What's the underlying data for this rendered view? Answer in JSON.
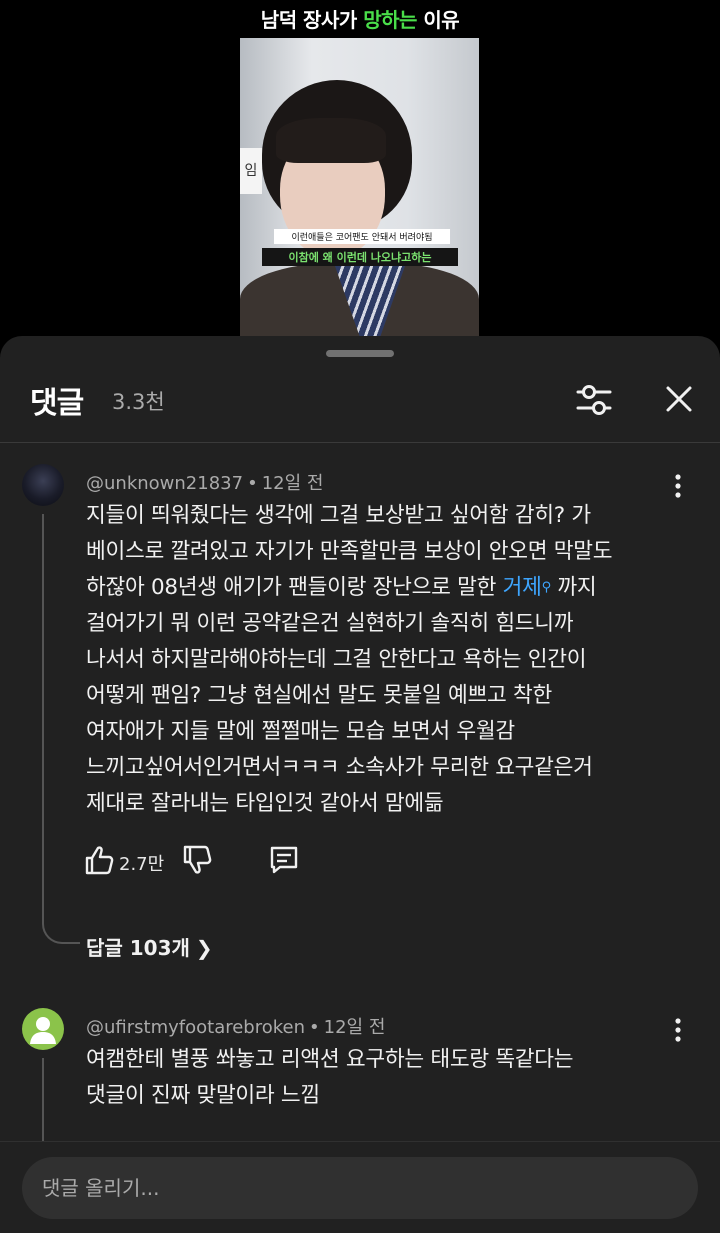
{
  "video": {
    "title_part1": "남덕 장사가 ",
    "title_highlight": "망하는",
    "title_part2": " 이유",
    "caption1": "이런애들은 코어팬도 안돼서 버려야됨",
    "caption2": "이참에 왜 이런데 나오냐고하는",
    "sign_text": "임"
  },
  "header": {
    "title": "댓글",
    "count": "3.3천",
    "filter_icon": "filter-sliders-icon",
    "close_icon": "close-icon"
  },
  "comments": [
    {
      "author": "@unknown21837",
      "time": "12일 전",
      "lines": [
        "지들이 띄워줬다는 생각에 그걸 보상받고 싶어함 감히? 가",
        "베이스로 깔려있고 자기가 만족할만큼 보상이 안오면 막말도",
        "하잖아 08년생 애기가 팬들이랑 장난으로 말한 ",
        "걸어가기 뭐 이런 공약같은건 실현하기 솔직히 힘드니까",
        "나서서 하지말라해야하는데 그걸 안한다고 욕하는 인간이",
        "어떻게 팬임? 그냥 현실에선 말도 못붙일 예쁘고 착한",
        "여자애가 지들 말에 쩔쩔매는 모습 보면서 우월감",
        "느끼고싶어서인거면서ㅋㅋㅋ 소속사가 무리한 요구같은거",
        "제대로 잘라내는 타입인것 같아서 맘에듦"
      ],
      "link_text": "거제",
      "line3_tail": " 까지",
      "likes": "2.7만",
      "replies": "답글 103개"
    },
    {
      "author": "@ufirstmyfootarebroken",
      "time": "12일 전",
      "lines": [
        "여캠한테 별풍 쏴놓고 리액션 요구하는 태도랑 똑같다는",
        "댓글이 진짜 맞말이라 느낌"
      ]
    }
  ],
  "input": {
    "placeholder": "댓글 올리기..."
  }
}
